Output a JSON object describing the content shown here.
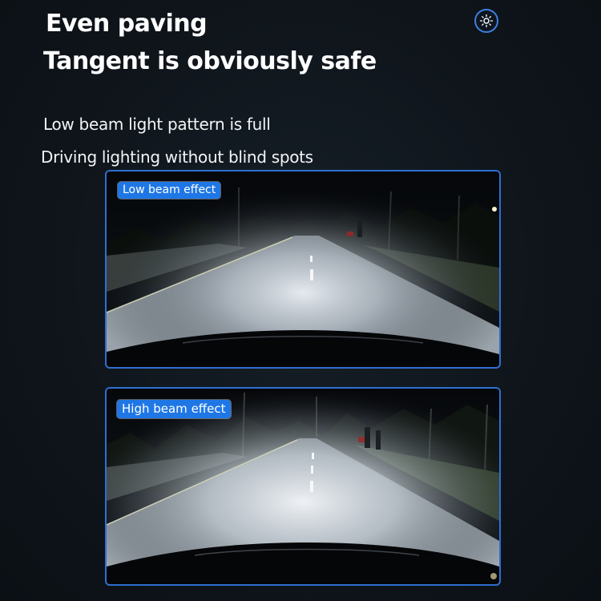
{
  "headline": {
    "line1": "Even paving",
    "line2": "Tangent is obviously safe"
  },
  "subtext": {
    "line1": "Low beam light pattern is full",
    "line2": "Driving lighting without blind spots"
  },
  "panels": {
    "low": {
      "label": "Low beam effect"
    },
    "high": {
      "label": "High beam effect"
    }
  },
  "icons": {
    "top_right": "sun-icon"
  },
  "colors": {
    "background": "#0f151b",
    "accent_border": "#2f6fd1",
    "badge_fill": "#1f77e6",
    "text": "#ffffff"
  }
}
